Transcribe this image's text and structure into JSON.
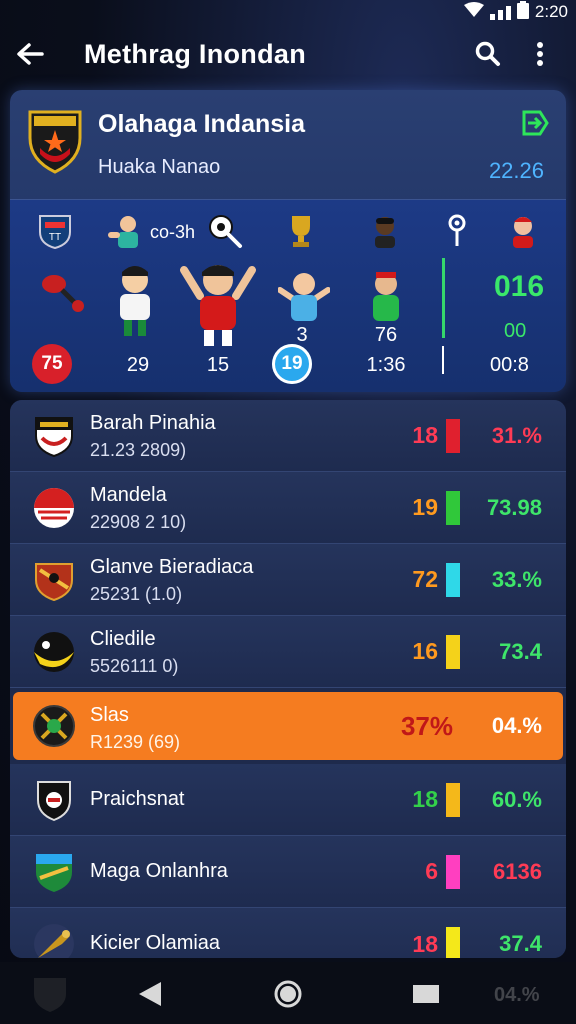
{
  "status": {
    "time": "2:20"
  },
  "appbar": {
    "title": "Methrag Inondan"
  },
  "card": {
    "team_name": "Olahaga Indansia",
    "team_sub": "Huaka Nanao",
    "head_value": "22.26",
    "icons_row_text": "co-3h",
    "stats": {
      "red_badge": "75",
      "s1": "29",
      "s2": "15",
      "s3_top": "3",
      "blue_badge": "19",
      "s4_top": "76",
      "s4": "1:36",
      "right_big": "016",
      "right_mid": "00",
      "right_low": "00:8"
    }
  },
  "rows": [
    {
      "name": "Barah Pinahia",
      "sub": "21.23 2809)",
      "num": "18",
      "num_color": "#ff3b55",
      "bar_color": "#e0202e",
      "pct": "31.%",
      "pct_color": "#ff3b55",
      "logo": "crest-icon"
    },
    {
      "name": "Mandela",
      "sub": "22908 2 10)",
      "num": "19",
      "num_color": "#ff9a1f",
      "bar_color": "#30c83a",
      "pct": "73.98",
      "pct_color": "#3ee56a",
      "logo": "half-circle-icon"
    },
    {
      "name": "Glanve Bieradiaca",
      "sub": "25231 (1.0)",
      "num": "72",
      "num_color": "#ff9a1f",
      "bar_color": "#2fd8e8",
      "pct": "33.%",
      "pct_color": "#3ee56a",
      "logo": "shield-icon"
    },
    {
      "name": "Cliedile",
      "sub": "5526111 0)",
      "num": "16",
      "num_color": "#ff9a1f",
      "bar_color": "#f4d21a",
      "pct": "73.4",
      "pct_color": "#3ee56a",
      "logo": "ball-icon"
    },
    {
      "name": "Slas",
      "sub": "R1239 (69)",
      "num": "37%",
      "num_color": "#c01818",
      "bar_color": "",
      "pct": "04.%",
      "pct_color": "#ffffff",
      "logo": "emblem-icon",
      "highlight": true
    },
    {
      "name": "Praichsnat",
      "sub": "",
      "num": "18",
      "num_color": "#33d04a",
      "bar_color": "#f4b81a",
      "pct": "60.%",
      "pct_color": "#3ee56a",
      "logo": "shield-dark-icon"
    },
    {
      "name": "Maga Onlanhra",
      "sub": "",
      "num": "6",
      "num_color": "#ff3b55",
      "bar_color": "#ff3fc0",
      "pct": "6136",
      "pct_color": "#ff3b55",
      "logo": "green-shield-icon"
    },
    {
      "name": "Kicier Olamiaa",
      "sub": "",
      "num": "18",
      "num_color": "#ff3b55",
      "bar_color": "#f4e81a",
      "pct": "37.4",
      "pct_color": "#3ee56a",
      "logo": "horn-icon"
    }
  ],
  "nav": {
    "ghost_value": "04.%"
  }
}
